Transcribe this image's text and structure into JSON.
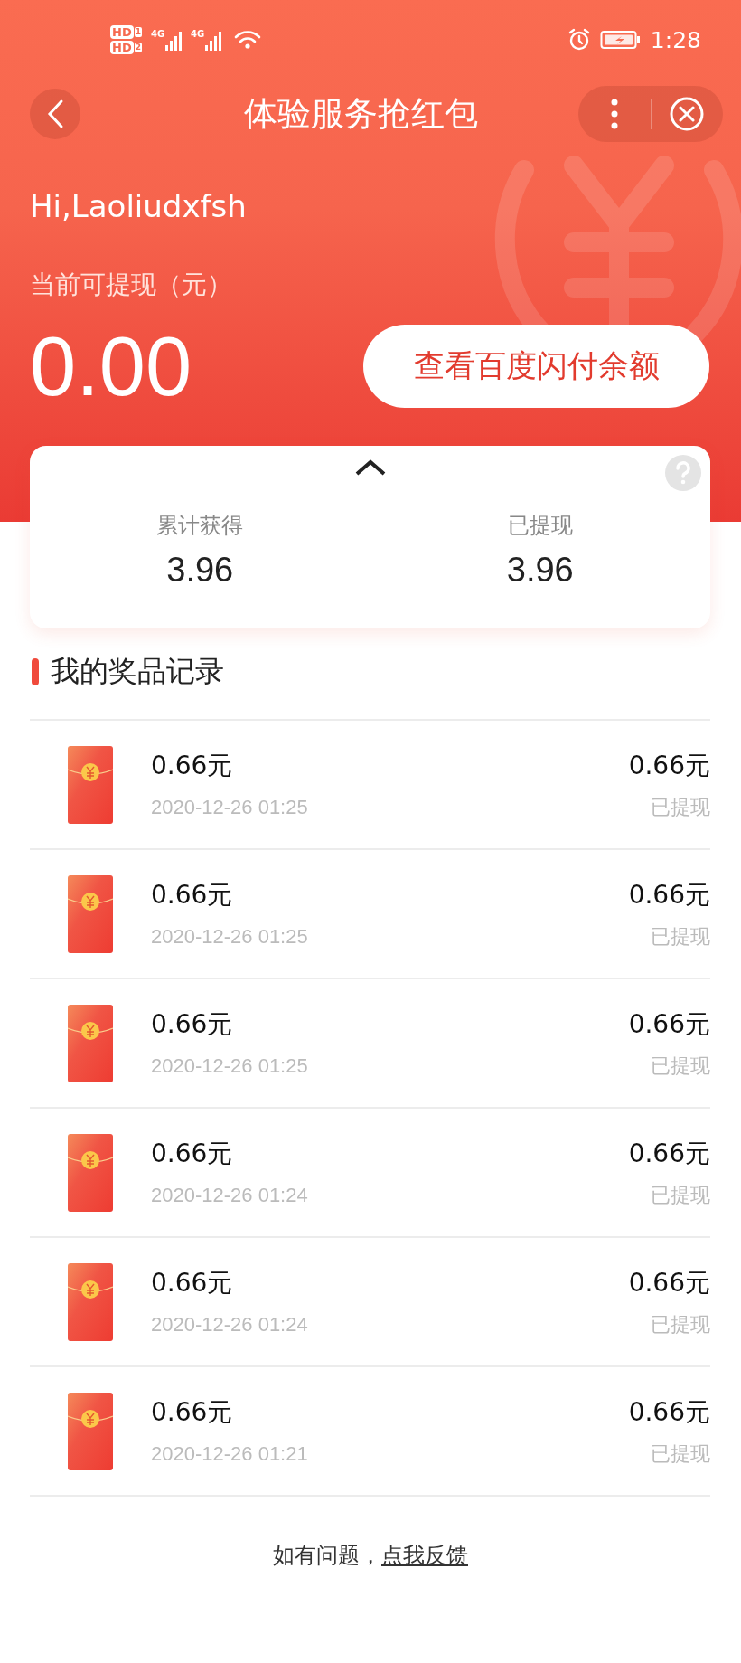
{
  "status_bar": {
    "sims": [
      {
        "label": "HD",
        "slot": "1",
        "network": "4G"
      },
      {
        "label": "HD",
        "slot": "2",
        "network": "4G"
      }
    ],
    "time": "1:28"
  },
  "nav": {
    "title": "体验服务抢红包"
  },
  "header": {
    "greeting": "Hi,Laoliudxfsh",
    "balance_label": "当前可提现（元）",
    "balance": "0.00",
    "balance_button": "查看百度闪付余额"
  },
  "summary": {
    "stats": [
      {
        "label": "累计获得",
        "value": "3.96"
      },
      {
        "label": "已提现",
        "value": "3.96"
      }
    ]
  },
  "records": {
    "title": "我的奖品记录",
    "items": [
      {
        "title": "0.66元",
        "time": "2020-12-26 01:25",
        "amount": "0.66元",
        "status": "已提现"
      },
      {
        "title": "0.66元",
        "time": "2020-12-26 01:25",
        "amount": "0.66元",
        "status": "已提现"
      },
      {
        "title": "0.66元",
        "time": "2020-12-26 01:25",
        "amount": "0.66元",
        "status": "已提现"
      },
      {
        "title": "0.66元",
        "time": "2020-12-26 01:24",
        "amount": "0.66元",
        "status": "已提现"
      },
      {
        "title": "0.66元",
        "time": "2020-12-26 01:24",
        "amount": "0.66元",
        "status": "已提现"
      },
      {
        "title": "0.66元",
        "time": "2020-12-26 01:21",
        "amount": "0.66元",
        "status": "已提现"
      }
    ]
  },
  "footer": {
    "text": "如有问题，",
    "link": "点我反馈"
  }
}
